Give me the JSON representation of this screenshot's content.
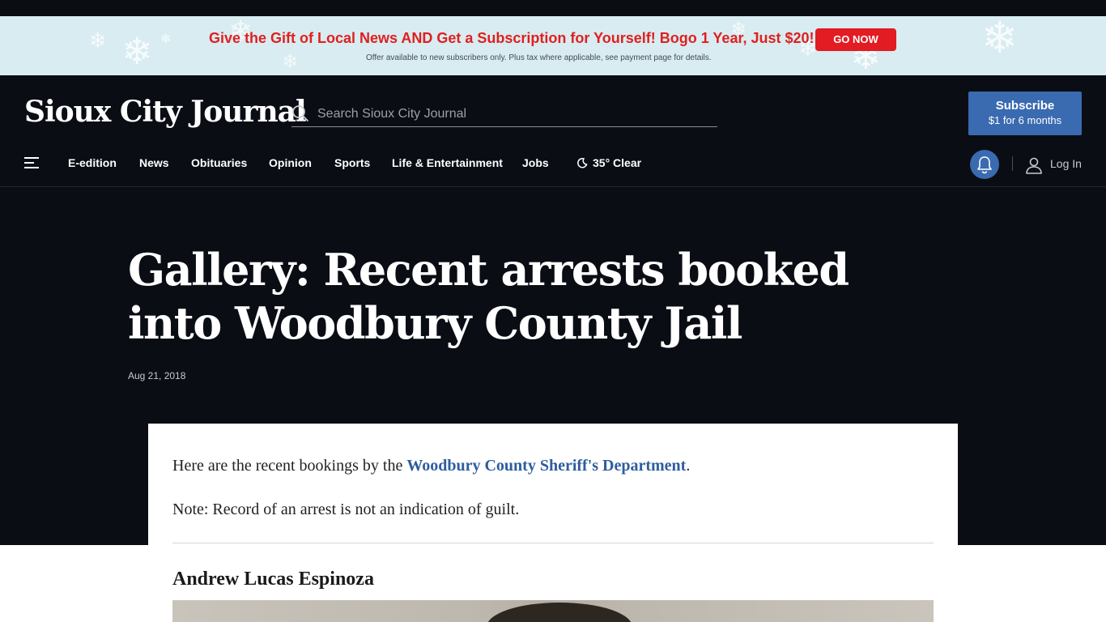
{
  "promo": {
    "headline": "Give the Gift of Local News AND Get a Subscription for Yourself! Bogo 1 Year, Just $20!",
    "fine_print": "Offer available to new subscribers only. Plus tax where applicable, see payment page for details.",
    "button": "GO NOW",
    "snowflake": "❄"
  },
  "header": {
    "logo": "Sioux City Journal",
    "search_placeholder": "Search Sioux City Journal",
    "subscribe_title": "Subscribe",
    "subscribe_offer": "$1 for 6 months"
  },
  "nav": {
    "items": [
      "E-edition",
      "News",
      "Obituaries",
      "Opinion",
      "Sports",
      "Life & Entertainment",
      "Jobs"
    ],
    "weather": "35° Clear",
    "login": "Log In"
  },
  "article": {
    "title": "Gallery: Recent arrests booked into Woodbury County Jail",
    "date": "Aug 21, 2018",
    "intro_prefix": "Here are the recent bookings by the ",
    "intro_link": "Woodbury County Sheriff's Department",
    "intro_suffix": ".",
    "note": "Note: Record of an arrest is not an indication of guilt.",
    "first_person": "Andrew Lucas Espinoza"
  },
  "colors": {
    "promo_bg": "#d8ecf1",
    "promo_red": "#e0201f",
    "header_bg": "#0a0d14",
    "brand_blue": "#3a6ab0",
    "link_blue": "#2f5d9e"
  }
}
